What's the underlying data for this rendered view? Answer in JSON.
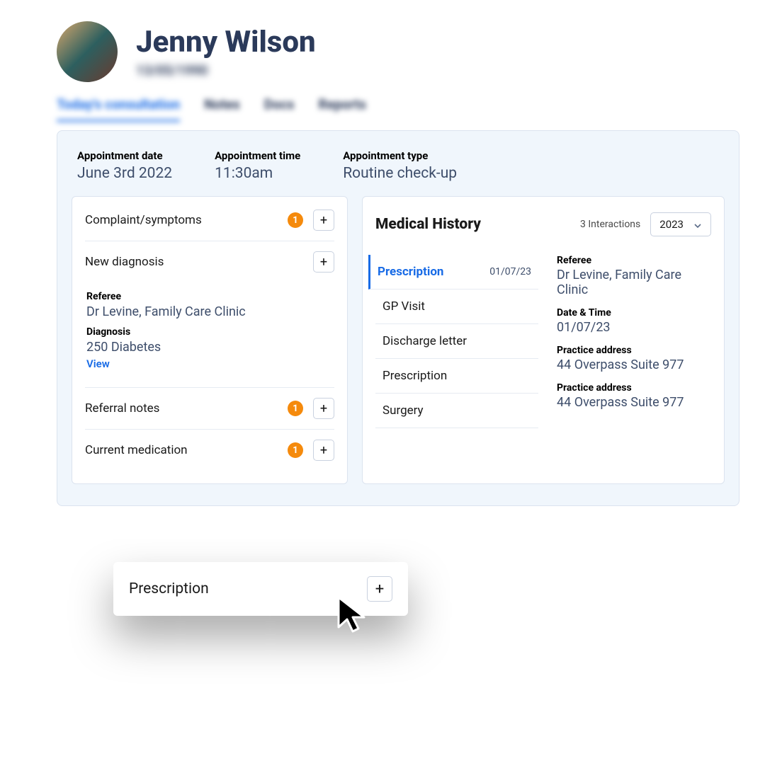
{
  "patient": {
    "name": "Jenny Wilson",
    "dob": "13/05/1990"
  },
  "tabs": [
    {
      "label": "Today's consultation",
      "active": true
    },
    {
      "label": "Notes",
      "active": false
    },
    {
      "label": "Docs",
      "active": false
    },
    {
      "label": "Reports",
      "active": false
    }
  ],
  "appointment": {
    "date_label": "Appointment date",
    "date_value": "June 3rd 2022",
    "time_label": "Appointment time",
    "time_value": "11:30am",
    "type_label": "Appointment type",
    "type_value": "Routine check-up"
  },
  "consultation": {
    "complaint": {
      "title": "Complaint/symptoms",
      "count": "1"
    },
    "new_diagnosis": {
      "title": "New diagnosis",
      "referee_label": "Referee",
      "referee_value": "Dr Levine, Family Care Clinic",
      "diagnosis_label": "Diagnosis",
      "diagnosis_value": "250 Diabetes",
      "view_link": "View"
    },
    "referral_notes": {
      "title": "Referral notes",
      "count": "1"
    },
    "current_medication": {
      "title": "Current medication",
      "count": "1"
    }
  },
  "history": {
    "title": "Medical History",
    "interactions": "3 Interactions",
    "year": "2023",
    "items": [
      {
        "label": "Prescription",
        "date": "01/07/23",
        "active": true
      },
      {
        "label": "GP Visit"
      },
      {
        "label": "Discharge letter"
      },
      {
        "label": "Prescription"
      },
      {
        "label": "Surgery"
      }
    ],
    "detail": {
      "referee_label": "Referee",
      "referee_value": "Dr Levine, Family Care Clinic",
      "datetime_label": "Date & Time",
      "datetime_value": "01/07/23",
      "address1_label": "Practice address",
      "address1_value": "44 Overpass Suite 977",
      "address2_label": "Practice address",
      "address2_value": "44 Overpass Suite 977"
    }
  },
  "popup": {
    "title": "Prescription"
  }
}
